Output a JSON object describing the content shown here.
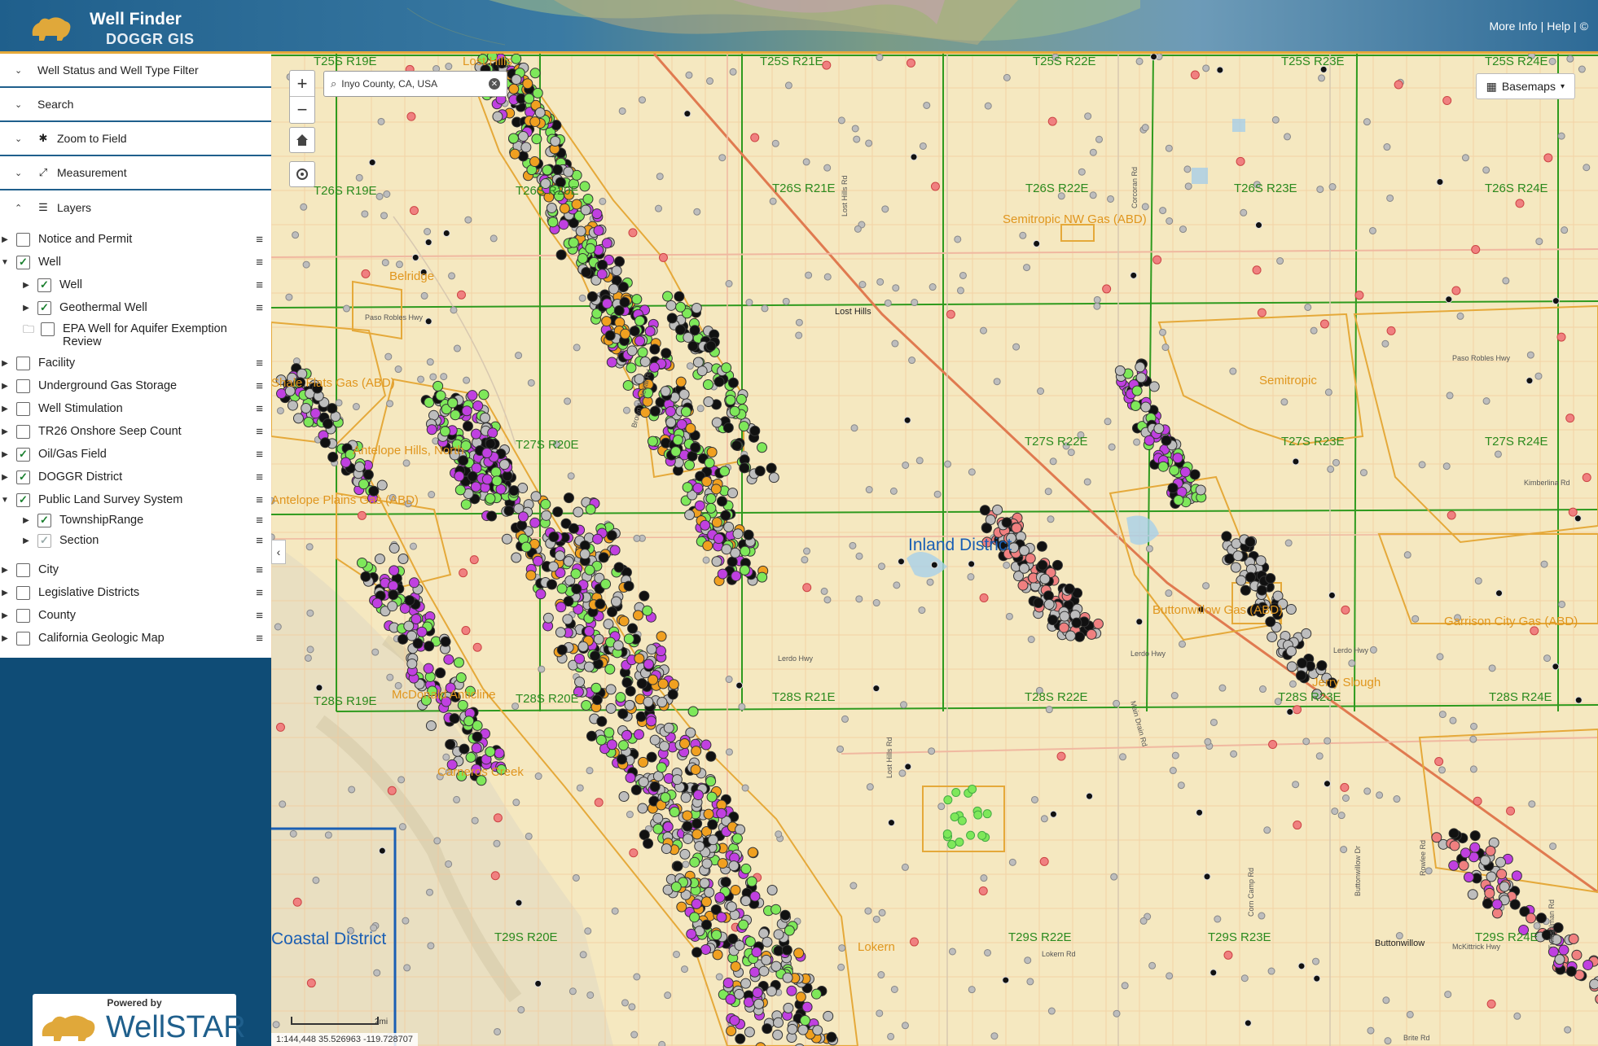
{
  "header": {
    "title": "Well Finder",
    "subtitle": "DOGGR GIS",
    "links": [
      "More Info",
      "Help",
      "©"
    ],
    "separator": "|"
  },
  "sidebar": {
    "accordion": [
      {
        "label": "Well Status and Well Type Filter",
        "icon": "chevron-down"
      },
      {
        "label": "Search",
        "icon": "chevron-down"
      },
      {
        "label": "Zoom to Field",
        "icon": "asterisk"
      },
      {
        "label": "Measurement",
        "icon": "resize-arrows"
      },
      {
        "label": "Layers",
        "icon": "list"
      }
    ],
    "layers": [
      {
        "label": "Notice and Permit",
        "checked": false
      },
      {
        "label": "Well",
        "checked": true,
        "expanded": true
      },
      {
        "label": "Well",
        "checked": true,
        "sub": true
      },
      {
        "label": "Geothermal Well",
        "checked": true,
        "sub": true
      },
      {
        "label": "EPA Well for Aquifer Exemption Review",
        "checked": false,
        "folder": true
      },
      {
        "label": "Facility",
        "checked": false
      },
      {
        "label": "Underground Gas Storage",
        "checked": false
      },
      {
        "label": "Well Stimulation",
        "checked": false
      },
      {
        "label": "TR26 Onshore Seep Count",
        "checked": false
      },
      {
        "label": "Oil/Gas Field",
        "checked": true
      },
      {
        "label": "DOGGR District",
        "checked": true
      },
      {
        "label": "Public Land Survey System",
        "checked": true,
        "expanded": true
      },
      {
        "label": "TownshipRange",
        "checked": true,
        "sub": true
      },
      {
        "label": "Section",
        "checked": true,
        "sub": true,
        "dim": true
      },
      {
        "label": "City",
        "checked": false
      },
      {
        "label": "Legislative Districts",
        "checked": false
      },
      {
        "label": "County",
        "checked": false
      },
      {
        "label": "California Geologic Map",
        "checked": false
      }
    ],
    "powered_by": "Powered by",
    "brand": "WellSTAR"
  },
  "map": {
    "search_value": "Inyo County, CA, USA",
    "basemaps_label": "Basemaps",
    "scale_label": "2mi",
    "coords_text": "1:144,448  35.526963  -119.728707",
    "township_labels": [
      "T25S R19E",
      "T25S R21E",
      "T25S R22E",
      "T25S R23E",
      "T25S R24E",
      "T26S R19E",
      "T26S R20E",
      "T26S R21E",
      "T26S R22E",
      "T26S R23E",
      "T26S R24E",
      "T27S R20E",
      "T27S R22E",
      "T27S R23E",
      "T27S R24E",
      "T28S R19E",
      "T28S R20E",
      "T28S R21E",
      "T28S R22E",
      "T28S R23E",
      "T28S R24E",
      "T29S R20E",
      "T29S R22E",
      "T29S R23E",
      "T29S R24E"
    ],
    "field_labels": [
      "Lost Hills",
      "Semitropic NW Gas (ABD)",
      "Shale Flats Gas (ABD)",
      "Antelope Hills, North",
      "Antelope Plains Gas (ABD)",
      "Belridge",
      "McDonald Anticline",
      "Carneros Creek",
      "Buttonwillow Gas (ABD)",
      "Garrison City Gas (ABD)",
      "Jerry Slough",
      "Semitropic",
      "Lokern"
    ],
    "district_labels": [
      "Inland District",
      "Coastal District"
    ],
    "place_labels": [
      "Lost Hills",
      "Buttonwillow"
    ],
    "road_labels": [
      "Paso Robles Hwy",
      "Lerdo Hwy",
      "Kimberlina Rd",
      "Corcoran Rd",
      "Lost Hills Rd",
      "Brown Material Rd",
      "Buttonwillow Dr",
      "Lokern Rd",
      "Main Drain Rd",
      "Corn Camp Rd",
      "Brite Rd",
      "Rowlee Rd",
      "McKittrick Hwy",
      "Twisselman Rd"
    ],
    "colors": {
      "background": "#f5e8c0",
      "township_lines": "#2e9a1e",
      "field_outline": "#e5a93a",
      "district_line": "#1a5fb4",
      "well_green": "#7ee85a",
      "well_magenta": "#c040e0",
      "well_orange": "#f0a020",
      "well_black": "#111111",
      "well_gray": "#bdbdbd",
      "well_pink": "#f08080"
    }
  }
}
